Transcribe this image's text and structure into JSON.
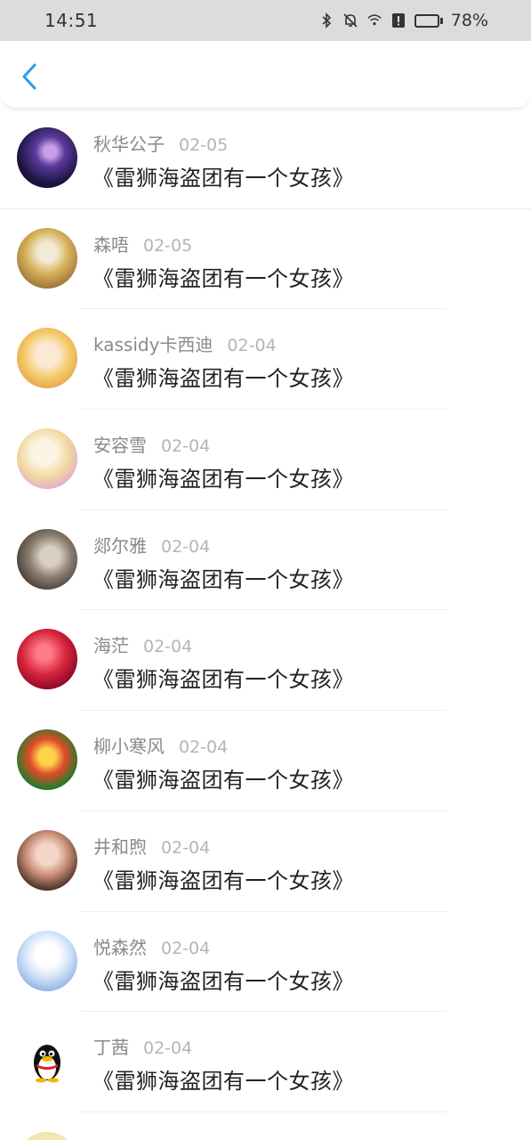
{
  "status_bar": {
    "time": "14:51",
    "battery_percent": "78%",
    "battery_level": 0.78,
    "icons": [
      "bluetooth-icon",
      "mute-icon",
      "wifi-icon",
      "alert-icon",
      "battery-icon"
    ]
  },
  "header": {
    "back_icon": "chevron-left-icon",
    "accent_color": "#2b9be8"
  },
  "comments": [
    {
      "name": "秋华公子",
      "date": "02-05",
      "text": "《雷狮海盗团有一个女孩》"
    },
    {
      "name": "森唔",
      "date": "02-05",
      "text": "《雷狮海盗团有一个女孩》"
    },
    {
      "name": "kassidy卡西迪",
      "date": "02-04",
      "text": "《雷狮海盗团有一个女孩》"
    },
    {
      "name": "安容雪",
      "date": "02-04",
      "text": "《雷狮海盗团有一个女孩》"
    },
    {
      "name": "郯尔雅",
      "date": "02-04",
      "text": "《雷狮海盗团有一个女孩》"
    },
    {
      "name": "海茫",
      "date": "02-04",
      "text": "《雷狮海盗团有一个女孩》"
    },
    {
      "name": "柳小寒风",
      "date": "02-04",
      "text": "《雷狮海盗团有一个女孩》"
    },
    {
      "name": "井和煦",
      "date": "02-04",
      "text": "《雷狮海盗团有一个女孩》"
    },
    {
      "name": "悦森然",
      "date": "02-04",
      "text": "《雷狮海盗团有一个女孩》"
    },
    {
      "name": "丁茜",
      "date": "02-04",
      "text": "《雷狮海盗团有一个女孩》"
    }
  ]
}
